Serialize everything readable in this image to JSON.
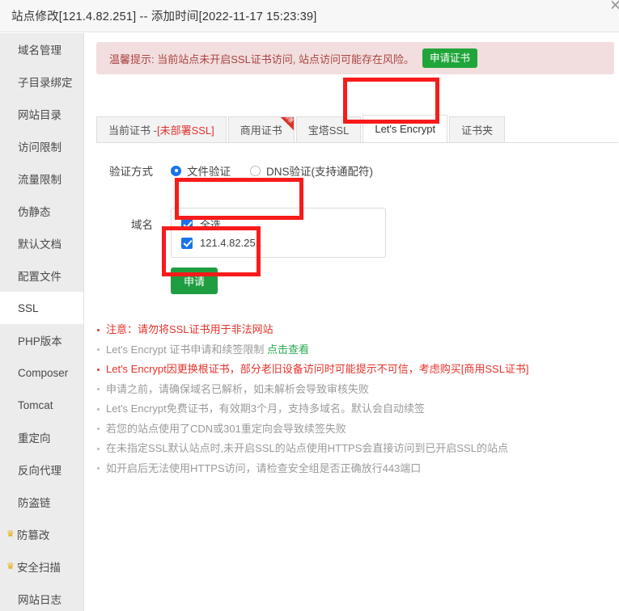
{
  "window": {
    "title": "站点修改[121.4.82.251] -- 添加时间[2022-11-17 15:23:39]"
  },
  "sidebar": {
    "items": [
      {
        "label": "域名管理",
        "active": false,
        "badge": ""
      },
      {
        "label": "子目录绑定",
        "active": false,
        "badge": ""
      },
      {
        "label": "网站目录",
        "active": false,
        "badge": ""
      },
      {
        "label": "访问限制",
        "active": false,
        "badge": ""
      },
      {
        "label": "流量限制",
        "active": false,
        "badge": ""
      },
      {
        "label": "伪静态",
        "active": false,
        "badge": ""
      },
      {
        "label": "默认文档",
        "active": false,
        "badge": ""
      },
      {
        "label": "配置文件",
        "active": false,
        "badge": ""
      },
      {
        "label": "SSL",
        "active": true,
        "badge": ""
      },
      {
        "label": "PHP版本",
        "active": false,
        "badge": ""
      },
      {
        "label": "Composer",
        "active": false,
        "badge": ""
      },
      {
        "label": "Tomcat",
        "active": false,
        "badge": ""
      },
      {
        "label": "重定向",
        "active": false,
        "badge": ""
      },
      {
        "label": "反向代理",
        "active": false,
        "badge": ""
      },
      {
        "label": "防盗链",
        "active": false,
        "badge": ""
      },
      {
        "label": "防篡改",
        "active": false,
        "badge": "♛"
      },
      {
        "label": "安全扫描",
        "active": false,
        "badge": "♛"
      },
      {
        "label": "网站日志",
        "active": false,
        "badge": ""
      }
    ]
  },
  "alert": {
    "text": "温馨提示: 当前站点未开启SSL证书访问, 站点访问可能存在风险。",
    "button_label": "申请证书",
    "button_color": "#20a53a",
    "background": "#f2dede",
    "text_color": "#a94442"
  },
  "tabs": [
    {
      "label": "当前证书 - ",
      "suffix": "[未部署SSL]",
      "active": false,
      "ribbon": ""
    },
    {
      "label": "商用证书",
      "suffix": "",
      "active": false,
      "ribbon": "特惠"
    },
    {
      "label": "宝塔SSL",
      "suffix": "",
      "active": false,
      "ribbon": ""
    },
    {
      "label": "Let's Encrypt",
      "suffix": "",
      "active": true,
      "ribbon": ""
    },
    {
      "label": "证书夹",
      "suffix": "",
      "active": false,
      "ribbon": ""
    }
  ],
  "form": {
    "verify_label": "验证方式",
    "verify_options": [
      {
        "label": "文件验证",
        "checked": true
      },
      {
        "label": "DNS验证(支持通配符)",
        "checked": false
      }
    ],
    "domain_label": "域名",
    "domains": [
      {
        "label": "全选",
        "checked": true
      },
      {
        "label": "121.4.82.251",
        "checked": true
      }
    ],
    "apply_label": "申请",
    "apply_color": "#1f9e41"
  },
  "notes": [
    {
      "text": "注意：请勿将SSL证书用于非法网站",
      "style": "red",
      "link": "",
      "link_style": "",
      "tail": ""
    },
    {
      "text": "Let's Encrypt 证书申请和续签限制 ",
      "style": "gray",
      "link": "点击查看",
      "link_style": "green",
      "tail": ""
    },
    {
      "text": "Let's Encrypt因更换根证书，部分老旧设备访问时可能提示不可信，考虑购买",
      "style": "red",
      "link": "[商用SSL证书]",
      "link_style": "red",
      "tail": ""
    },
    {
      "text": "申请之前，请确保域名已解析，如未解析会导致审核失败",
      "style": "gray",
      "link": "",
      "link_style": "",
      "tail": ""
    },
    {
      "text": "Let's Encrypt免费证书，有效期3个月，支持多域名。默认会自动续签",
      "style": "gray",
      "link": "",
      "link_style": "",
      "tail": ""
    },
    {
      "text": "若您的站点使用了CDN或301重定向会导致续签失败",
      "style": "gray",
      "link": "",
      "link_style": "",
      "tail": ""
    },
    {
      "text": "在未指定SSL默认站点时,未开启SSL的站点使用HTTPS会直接访问到已开启SSL的站点",
      "style": "gray",
      "link": "",
      "link_style": "",
      "tail": ""
    },
    {
      "text": "如开启后无法使用HTTPS访问，请检查安全组是否正确放行443端口",
      "style": "gray",
      "link": "",
      "link_style": "",
      "tail": ""
    }
  ],
  "annotations": {
    "color": "#f81b1b",
    "boxes": [
      "lets-encrypt-tab",
      "domain-checkbox-list",
      "apply-button"
    ]
  }
}
